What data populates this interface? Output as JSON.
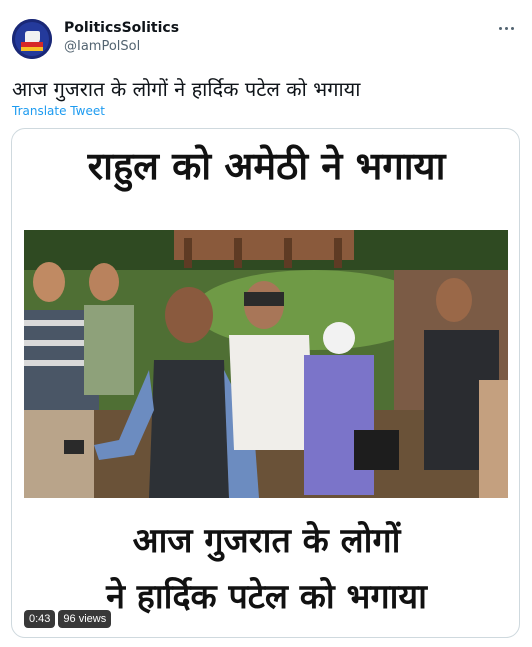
{
  "author": {
    "display_name": "PoliticsSolitics",
    "handle": "@IamPolSol",
    "avatar_icon": "politics-solitics-logo"
  },
  "more_icon": "more-options-icon",
  "tweet": {
    "text": "आज गुजरात के लोगों ने हार्दिक पटेल को भगाया",
    "translate_label": "Translate Tweet"
  },
  "media": {
    "caption_top": "राहुल को अमेठी ने भगाया",
    "caption_bottom_line1": "आज गुजरात के लोगों",
    "caption_bottom_line2": "ने हार्दिक पटेल को भगाया",
    "duration": "0:43",
    "views": "96 views"
  },
  "colors": {
    "accent": "#1d9bf0",
    "secondary_text": "#536471",
    "border": "#cfd9de"
  }
}
